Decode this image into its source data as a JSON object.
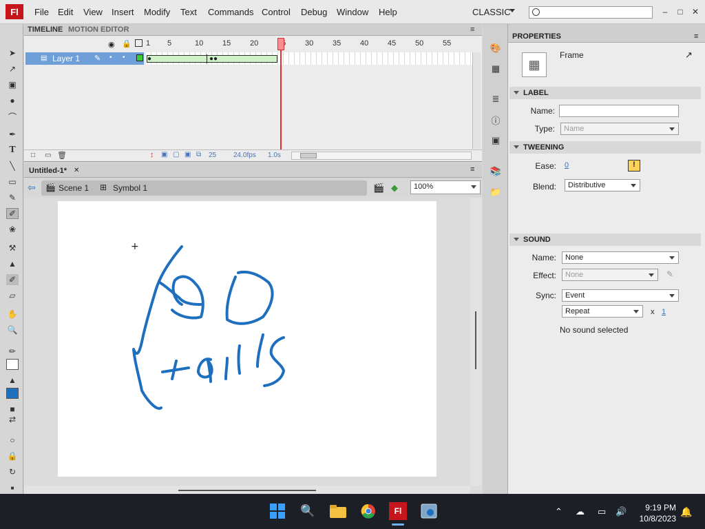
{
  "app": {
    "logo": "Fl",
    "workspace": "CLASSIC"
  },
  "menu": [
    "File",
    "Edit",
    "View",
    "Insert",
    "Modify",
    "Text",
    "Commands",
    "Control",
    "Debug",
    "Window",
    "Help"
  ],
  "window_controls": {
    "minimize": "–",
    "maximize": "□",
    "close": "✕"
  },
  "timeline": {
    "tabs": [
      "TIMELINE",
      "MOTION EDITOR"
    ],
    "layer_name": "Layer 1",
    "ruler": [
      "1",
      "5",
      "10",
      "15",
      "20",
      "25",
      "30",
      "35",
      "40",
      "45",
      "50",
      "55"
    ],
    "current_frame": "25",
    "fps": "24.0fps",
    "time": "1.0s"
  },
  "document": {
    "tab": "Untitled-1*",
    "close": "✕"
  },
  "edit_bar": {
    "scene": "Scene 1",
    "symbol": "Symbol 1",
    "zoom": "100%"
  },
  "properties": {
    "tab": "PROPERTIES",
    "type_label": "Frame",
    "label_section": "LABEL",
    "name_label": "Name:",
    "name_value": "",
    "type_field_label": "Type:",
    "type_value": "Name",
    "tweening_section": "TWEENING",
    "ease_label": "Ease:",
    "ease_value": "0",
    "blend_label": "Blend:",
    "blend_value": "Distributive",
    "sound_section": "SOUND",
    "sound_name_label": "Name:",
    "sound_name_value": "None",
    "effect_label": "Effect:",
    "effect_value": "None",
    "sync_label": "Sync:",
    "sync_value": "Event",
    "repeat_value": "Repeat",
    "repeat_x": "x",
    "repeat_count": "1",
    "no_sound": "No sound selected"
  },
  "taskbar": {
    "time": "9:19 PM",
    "date": "10/8/2023"
  },
  "colors": {
    "stroke": "#1f6fbf",
    "accent": "#c4161c",
    "selection": "#6e9fd9"
  }
}
